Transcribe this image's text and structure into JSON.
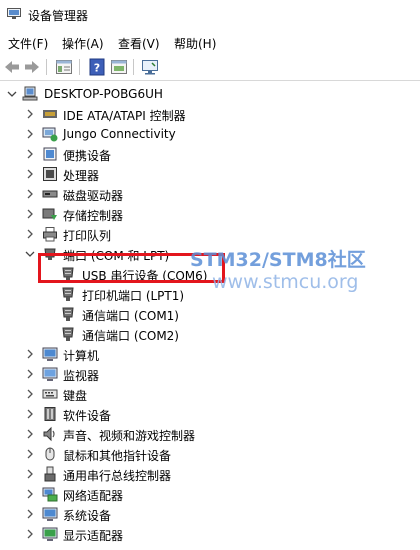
{
  "window": {
    "title": "设备管理器"
  },
  "menu": [
    "文件(F)",
    "操作(A)",
    "查看(V)",
    "帮助(H)"
  ],
  "toolbar": {
    "buttons": [
      "back-icon",
      "forward-icon",
      "properties-icon",
      "help-icon",
      "update-driver-icon",
      "scan-hardware-icon"
    ]
  },
  "tree": {
    "root": {
      "label": "DESKTOP-POBG6UH",
      "icon": "computer-icon",
      "expanded": true
    },
    "categories": [
      {
        "label": "IDE ATA/ATAPI 控制器",
        "icon": "ide-controller-icon"
      },
      {
        "label": "Jungo Connectivity",
        "icon": "jungo-icon"
      },
      {
        "label": "便携设备",
        "icon": "portable-device-icon"
      },
      {
        "label": "处理器",
        "icon": "processor-icon"
      },
      {
        "label": "磁盘驱动器",
        "icon": "disk-drive-icon"
      },
      {
        "label": "存储控制器",
        "icon": "storage-controller-icon"
      },
      {
        "label": "打印队列",
        "icon": "print-queue-icon"
      },
      {
        "label": "端口 (COM 和 LPT)",
        "icon": "port-icon",
        "expanded": true,
        "children": [
          {
            "label": "USB 串行设备 (COM6)",
            "icon": "port-connector-icon",
            "highlighted": true
          },
          {
            "label": "打印机端口 (LPT1)",
            "icon": "port-connector-icon"
          },
          {
            "label": "通信端口 (COM1)",
            "icon": "port-connector-icon"
          },
          {
            "label": "通信端口 (COM2)",
            "icon": "port-connector-icon"
          }
        ]
      },
      {
        "label": "计算机",
        "icon": "computer-icon"
      },
      {
        "label": "监视器",
        "icon": "monitor-icon"
      },
      {
        "label": "键盘",
        "icon": "keyboard-icon"
      },
      {
        "label": "软件设备",
        "icon": "software-device-icon"
      },
      {
        "label": "声音、视频和游戏控制器",
        "icon": "sound-icon"
      },
      {
        "label": "鼠标和其他指针设备",
        "icon": "mouse-icon"
      },
      {
        "label": "通用串行总线控制器",
        "icon": "usb-icon"
      },
      {
        "label": "网络适配器",
        "icon": "network-adapter-icon"
      },
      {
        "label": "系统设备",
        "icon": "system-device-icon"
      },
      {
        "label": "显示适配器",
        "icon": "display-adapter-icon"
      }
    ]
  },
  "watermark": {
    "line1": "STM32/STM8社区",
    "line2": "www.stmcu.org"
  },
  "colors": {
    "highlight_border": "#e3151d",
    "watermark": "#5b8fd6"
  }
}
